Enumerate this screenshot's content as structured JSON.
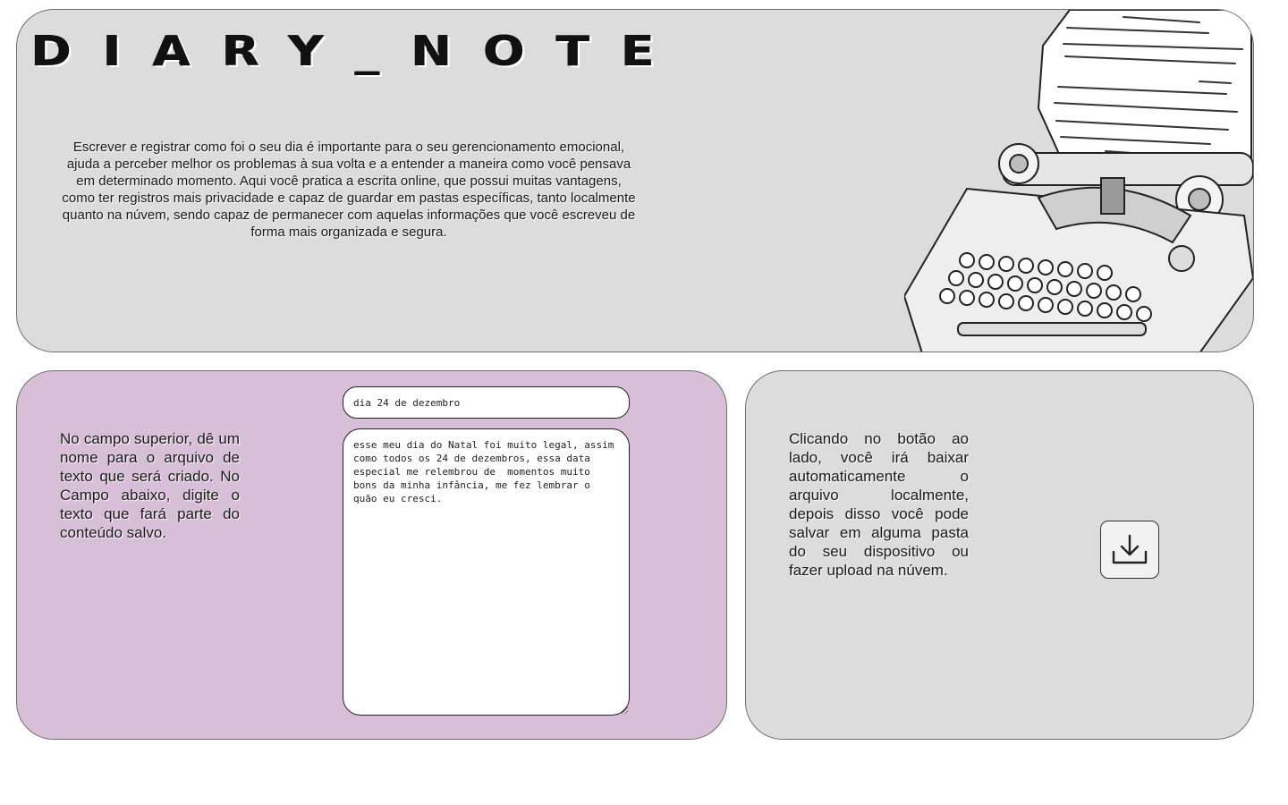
{
  "header": {
    "title": "DIARY_NOTE",
    "description": "Escrever e registrar como foi o seu dia é importante para o seu gerencionamento emocional, ajuda a perceber melhor os problemas à sua volta e a entender a maneira como você pensava em determinado momento. Aqui você pratica a escrita online, que possui muitas vantagens, como ter registros mais privacidade e capaz de guardar em pastas específicas, tanto localmente quanto na núvem, sendo capaz de permanecer com aquelas informações que você escreveu de forma mais organizada e segura.",
    "illustration_icon": "typewriter-icon"
  },
  "editor": {
    "instructions": "No campo superior, dê um nome para o arquivo de texto que será criado. No Campo abaixo, digite o texto que fará parte do conteúdo salvo.",
    "filename_value": "dia 24 de dezembro",
    "content_value": "esse meu dia do Natal foi muito legal, assim como todos os 24 de dezembros, essa data especial me relembrou de  momentos muito bons da minha infância, me fez lembrar o quão eu cresci."
  },
  "download": {
    "instructions": "Clicando no botão ao lado, você irá baixar automaticamente o arquivo localmente, depois disso você pode salvar em alguma pasta do seu dispositivo ou fazer upload na núvem.",
    "button_icon": "download-icon"
  },
  "colors": {
    "hero_bg": "#dcdcdc",
    "editor_bg": "#d8bfd8",
    "download_bg": "#dcdcdc",
    "text": "#1a1a1a"
  }
}
